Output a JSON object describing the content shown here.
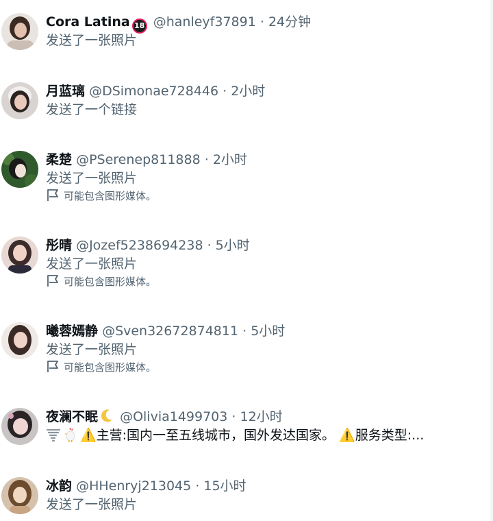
{
  "conversations": [
    {
      "name": "Cora Latina",
      "badge": "18",
      "handle": "@hanleyf37891",
      "time": "24分钟",
      "preview": "发送了一张照片",
      "avatar_colors": [
        "#e9e4df",
        "#3a2a22",
        "#d8b9a6"
      ]
    },
    {
      "name": "月蓝璃",
      "handle": "@DSimonae728446",
      "time": "2小时",
      "preview": "发送了一个链接",
      "avatar_colors": [
        "#d9d4d2",
        "#2b2320",
        "#eac9bd"
      ]
    },
    {
      "name": "柔楚",
      "handle": "@PSerenep811888",
      "time": "2小时",
      "preview": "发送了一张照片",
      "flag_note": "可能包含图形媒体。",
      "avatar_colors": [
        "#2f5a2c",
        "#1a1a1a",
        "#efe3d9"
      ]
    },
    {
      "name": "彤晴",
      "handle": "@Jozef5238694238",
      "time": "5小时",
      "preview": "发送了一张照片",
      "flag_note": "可能包含图形媒体。",
      "avatar_colors": [
        "#e8d8d3",
        "#3b2b2a",
        "#f2d2c6"
      ]
    },
    {
      "name": "曦蓉嫣静",
      "handle": "@Sven32672874811",
      "time": "5小时",
      "preview": "发送了一张照片",
      "flag_note": "可能包含图形媒体。",
      "avatar_colors": [
        "#efe9e6",
        "#3a2a26",
        "#f0d3c8"
      ]
    },
    {
      "name": "夜澜不眠",
      "handle": "@Olivia1499703",
      "time": "12小时",
      "preview": "⚠️主营:国内一至五线城市，国外发达国家。 ⚠️服务类型:...",
      "preview_icons": [
        "tornado-icon",
        "rooster-icon"
      ],
      "avatar_colors": [
        "#c9c4c4",
        "#2a2426",
        "#efd6d2"
      ]
    },
    {
      "name": "冰韵",
      "handle": "@HHenryj213045",
      "time": "15小时",
      "preview": "发送了一张照片",
      "avatar_colors": [
        "#d6c2ac",
        "#6b4a2e",
        "#f0d7c0"
      ]
    }
  ],
  "separator": "·",
  "colors": {
    "name": "#0f1419",
    "secondary": "#536471",
    "badge_ring": "#e0245e",
    "warning": "#f4b400"
  }
}
